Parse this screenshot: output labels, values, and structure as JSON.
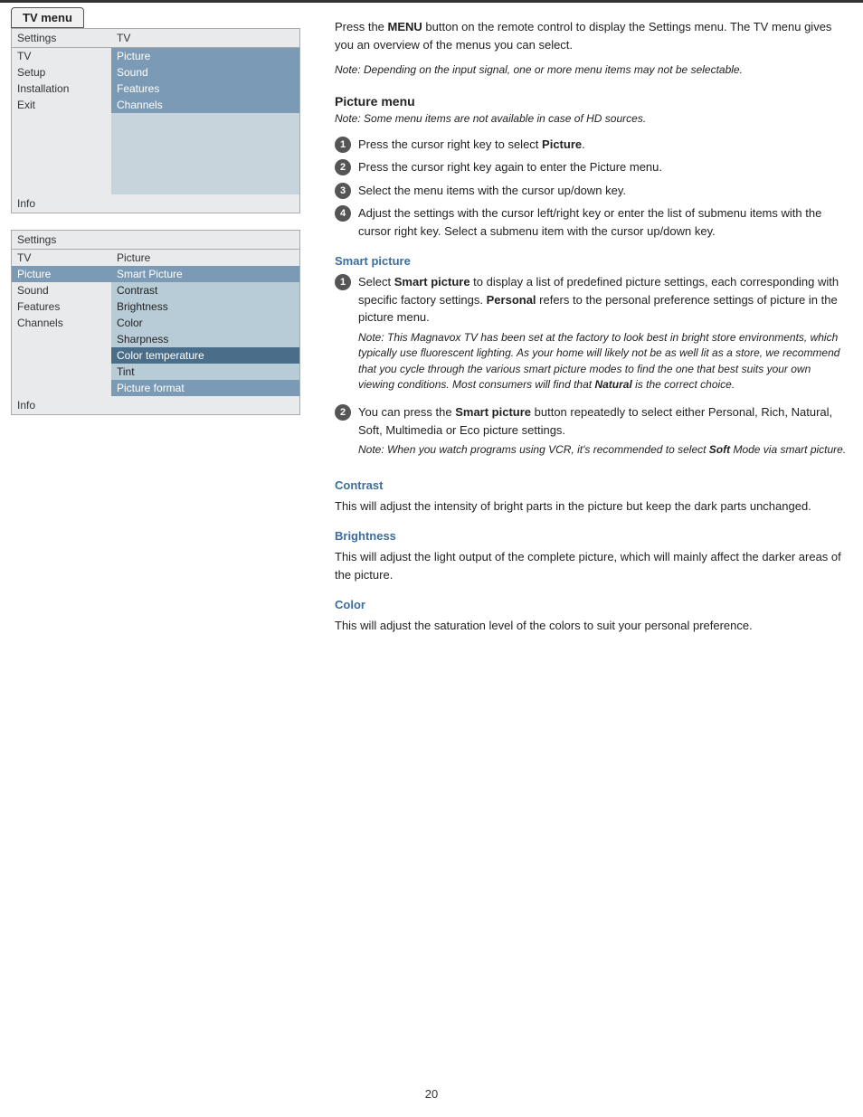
{
  "page": {
    "number": "20"
  },
  "tv_menu_label": "TV menu",
  "menu1": {
    "header_left": "Settings",
    "header_right": "TV",
    "rows": [
      {
        "left": "TV",
        "right": "Picture",
        "right_style": "highlighted",
        "left_active": false
      },
      {
        "left": "Setup",
        "right": "Sound",
        "right_style": "highlighted",
        "left_active": false
      },
      {
        "left": "Installation",
        "right": "Features",
        "right_style": "highlighted",
        "left_active": false
      },
      {
        "left": "Exit",
        "right": "Channels",
        "right_style": "highlighted",
        "left_active": false
      },
      {
        "left": "",
        "right": "",
        "right_style": "empty",
        "left_active": false
      },
      {
        "left": "",
        "right": "",
        "right_style": "empty",
        "left_active": false
      },
      {
        "left": "",
        "right": "",
        "right_style": "empty",
        "left_active": false
      },
      {
        "left": "",
        "right": "",
        "right_style": "empty",
        "left_active": false
      },
      {
        "left": "",
        "right": "",
        "right_style": "empty",
        "left_active": false
      }
    ],
    "info": "Info"
  },
  "menu2": {
    "header_left": "Settings",
    "header_right": "",
    "rows": [
      {
        "left": "TV",
        "right": "Picture",
        "right_style": "normal",
        "left_active": false
      },
      {
        "left": "Picture",
        "right": "Smart Picture",
        "right_style": "highlighted",
        "left_active": true
      },
      {
        "left": "Sound",
        "right": "Contrast",
        "right_style": "light-blue",
        "left_active": false
      },
      {
        "left": "Features",
        "right": "Brightness",
        "right_style": "light-blue",
        "left_active": false
      },
      {
        "left": "Channels",
        "right": "Color",
        "right_style": "light-blue",
        "left_active": false
      },
      {
        "left": "",
        "right": "Sharpness",
        "right_style": "light-blue",
        "left_active": false
      },
      {
        "left": "",
        "right": "Color temperature",
        "right_style": "dark-blue",
        "left_active": false
      },
      {
        "left": "",
        "right": "Tint",
        "right_style": "light-blue",
        "left_active": false
      },
      {
        "left": "",
        "right": "Picture format",
        "right_style": "highlighted",
        "left_active": false
      }
    ],
    "info": "Info"
  },
  "right": {
    "intro": "Press the MENU button on the remote control to display the Settings menu. The TV menu gives you an overview of the menus you can select.",
    "intro_note": "Note: Depending on the input signal, one or more menu items may not be selectable.",
    "picture_menu": {
      "title": "Picture menu",
      "note": "Note: Some menu items are not available in case of HD sources.",
      "steps": [
        {
          "num": "1",
          "text": "Press the cursor right key to select Picture."
        },
        {
          "num": "2",
          "text": "Press the cursor right key again to enter the Picture menu."
        },
        {
          "num": "3",
          "text": "Select the menu items with the cursor up/down key."
        },
        {
          "num": "4",
          "text": "Adjust the settings with the cursor left/right key or enter the list of submenu items with the cursor right key. Select a submenu item with the cursor up/down key."
        }
      ]
    },
    "smart_picture": {
      "title": "Smart picture",
      "steps": [
        {
          "num": "1",
          "text": "Select Smart picture to display a list of predefined picture settings, each corresponding with specific factory settings. Personal refers to the personal preference settings of picture in the picture menu.",
          "note": "Note: This Magnavox TV has been set at the factory to look best in bright store environments, which typically use fluorescent lighting. As your home will likely not be as well lit as a store, we recommend that you cycle through the various smart picture modes to find the one that best suits your own viewing conditions. Most consumers will find that Natural is the correct choice."
        },
        {
          "num": "2",
          "text": "You can press the Smart picture button repeatedly to select either Personal, Rich, Natural, Soft, Multimedia or Eco picture settings.",
          "note": "Note: When you watch programs using VCR, it's recommended to select Soft Mode via smart picture."
        }
      ]
    },
    "contrast": {
      "title": "Contrast",
      "text": "This will adjust the intensity of bright parts in the picture but keep the dark parts unchanged."
    },
    "brightness": {
      "title": "Brightness",
      "text": "This will adjust the light output of the complete picture, which will mainly affect the darker areas of the picture."
    },
    "color": {
      "title": "Color",
      "text": "This will adjust the saturation level of the colors to suit your personal preference."
    }
  }
}
